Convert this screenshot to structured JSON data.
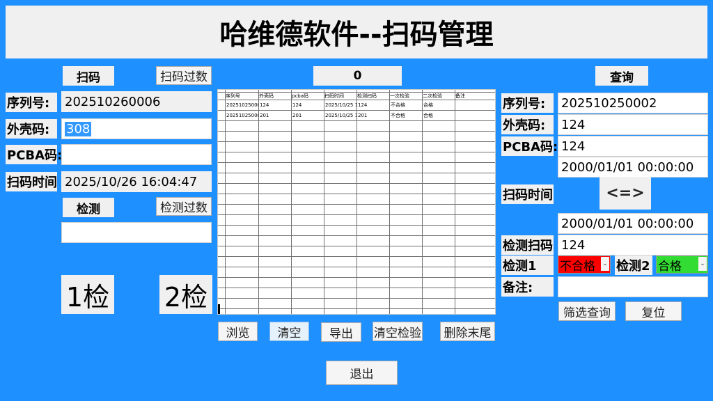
{
  "app": {
    "title": "哈维德软件--扫码管理"
  },
  "colors": {
    "background": "#1E90FF",
    "fail_bg": "#FF0000",
    "pass_bg": "#32DC32"
  },
  "scan": {
    "button_label": "扫码",
    "over_count_button": "扫码过数",
    "count": "0",
    "serial_label": "序列号:",
    "serial_value": "202510260006",
    "shell_label": "外壳码:",
    "shell_value": "308",
    "pcba_label": "PCBA码:",
    "pcba_value": "",
    "time_label": "扫码时间",
    "time_value": "2025/10/26 16:04:47"
  },
  "inspect": {
    "button_label": "检测",
    "over_count_button": "检测过数",
    "input_value": "",
    "first_button": "1检",
    "second_button": "2检"
  },
  "table": {
    "columns": [
      "序列号",
      "外壳码",
      "pcba码",
      "扫码时间",
      "检测扫码",
      "一次检验",
      "二次检验",
      "备注"
    ],
    "rows": [
      [
        "20251025000",
        "124",
        "124",
        "2025/10/25 1",
        "124",
        "不合格",
        "合格",
        ""
      ],
      [
        "20251025000",
        "201",
        "201",
        "2025/10/25 1",
        "201",
        "不合格",
        "合格",
        ""
      ]
    ]
  },
  "actions": {
    "browse": "浏览",
    "clear": "清空",
    "export": "导出",
    "clear_inspect": "清空检验",
    "delete_tail": "删除末尾",
    "exit": "退出"
  },
  "query": {
    "button_label": "查询",
    "serial_label": "序列号:",
    "serial_value": "202510250002",
    "shell_label": "外壳码:",
    "shell_value": "124",
    "pcba_label": "PCBA码:",
    "pcba_value": "124",
    "time_start": "2000/01/01 00:00:00",
    "time_label": "扫码时间",
    "compare_button": "<=>",
    "time_end": "2000/01/01 00:00:00",
    "inspect_scan_label": "检测扫码",
    "inspect_scan_value": "124",
    "inspect1_label": "检测1",
    "inspect1_value": "不合格",
    "inspect2_label": "检测2",
    "inspect2_value": "合格",
    "note_label": "备注:",
    "note_value": "",
    "filter_button": "筛选查询",
    "reset_button": "复位"
  }
}
